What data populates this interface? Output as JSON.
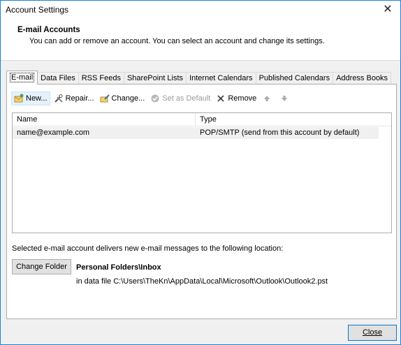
{
  "window": {
    "title": "Account Settings",
    "close_glyph": "✕"
  },
  "header": {
    "title": "E-mail Accounts",
    "subtitle": "You can add or remove an account. You can select an account and change its settings."
  },
  "tabs": [
    {
      "label": "E-mail",
      "active": true
    },
    {
      "label": "Data Files"
    },
    {
      "label": "RSS Feeds"
    },
    {
      "label": "SharePoint Lists"
    },
    {
      "label": "Internet Calendars"
    },
    {
      "label": "Published Calendars"
    },
    {
      "label": "Address Books"
    }
  ],
  "toolbar": {
    "new_label": "New...",
    "repair_label": "Repair...",
    "change_label": "Change...",
    "set_default_label": "Set as Default",
    "remove_label": "Remove"
  },
  "accounts": {
    "columns": {
      "name": "Name",
      "type": "Type"
    },
    "rows": [
      {
        "name": "name@example.com",
        "type": "POP/SMTP (send from this account by default)"
      }
    ]
  },
  "delivery": {
    "text": "Selected e-mail account delivers new e-mail messages to the following location:",
    "change_folder_label": "Change Folder",
    "folder": "Personal Folders\\Inbox",
    "path": "in data file C:\\Users\\TheKn\\AppData\\Local\\Microsoft\\Outlook\\Outlook2.pst"
  },
  "footer": {
    "close_label": "Close"
  },
  "icons": {
    "new": "new-account-icon",
    "repair": "repair-icon",
    "change": "change-icon",
    "set_default": "check-circle-icon",
    "remove": "remove-x-icon",
    "up": "arrow-up-icon",
    "down": "arrow-down-icon"
  }
}
